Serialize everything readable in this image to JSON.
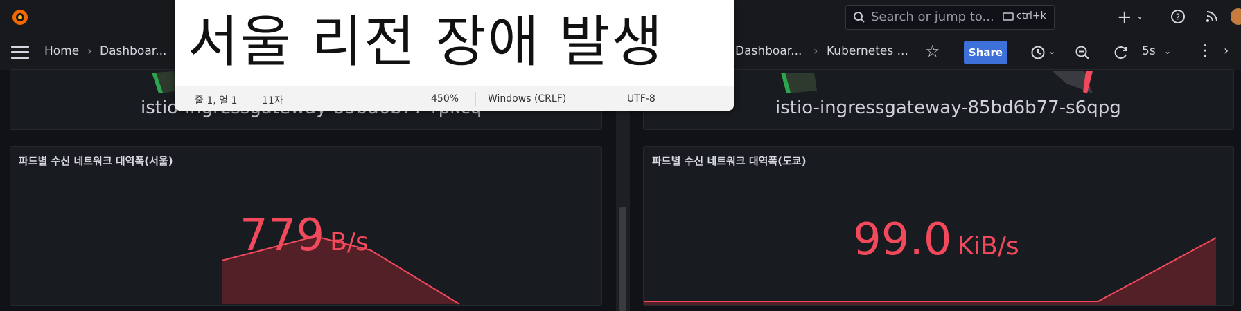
{
  "colors": {
    "accent": "#f2495c",
    "share_bg": "#3d71d9",
    "panel_bg": "#181b1f",
    "page_bg": "#111217"
  },
  "left": {
    "breadcrumbs": [
      "Home",
      "Dashboar..."
    ],
    "panel_top_pod": "istio-ingressgateway-85bd6b77-rpkcq",
    "panel_title": "파드별 수신 네트워크 대역폭(서울)",
    "stat_value": "779",
    "stat_unit": "B/s"
  },
  "right": {
    "breadcrumbs": [
      "Dashboar...",
      "Kubernetes ..."
    ],
    "search_placeholder": "Search or jump to...",
    "search_shortcut": "ctrl+k",
    "share_label": "Share",
    "refresh_rate": "5s",
    "panel_top_pod": "istio-ingressgateway-85bd6b77-s6qpg",
    "panel_title": "파드별 수신 네트워크 대역폭(도쿄)",
    "stat_value": "99.0",
    "stat_unit": "KiB/s"
  },
  "notepad": {
    "content": "서울 리전 장애 발생",
    "status": {
      "position": "줄 1, 열 1",
      "chars": "11자",
      "zoom": "450%",
      "line_ending": "Windows (CRLF)",
      "encoding": "UTF-8"
    }
  },
  "icons": [
    "grafana-logo-icon",
    "menu-icon",
    "search-icon",
    "plus-icon",
    "help-icon",
    "rss-icon",
    "star-icon",
    "clock-icon",
    "zoom-out-icon",
    "refresh-icon",
    "more-icon"
  ]
}
